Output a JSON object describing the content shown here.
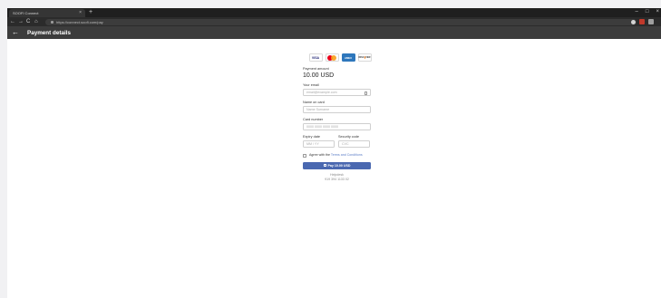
{
  "browser": {
    "tab_title": "SOOFI Connect",
    "tab_close": "×",
    "new_tab": "+",
    "url": "https://connect.soofi.com/pay",
    "controls": {
      "minimize": "–",
      "maximize": "□",
      "close": "×"
    },
    "nav": {
      "back": "←",
      "forward": "→",
      "reload": "C",
      "home": "⌂"
    }
  },
  "header": {
    "back_icon": "←",
    "title": "Payment details"
  },
  "payment": {
    "card_brands": [
      {
        "name": "VISA"
      },
      {
        "name": "Mastercard"
      },
      {
        "name": "AMERICAN EXPRESS"
      },
      {
        "name": "DISCOVER"
      }
    ],
    "amount_label": "Payment amount",
    "amount": "10.00 USD",
    "email_label": "Your email",
    "email_placeholder": "email@example.com",
    "name_label": "Name on card",
    "name_placeholder": "Name Surname",
    "card_label": "Card number",
    "card_placeholder": "0000 0000 0000 0000",
    "expiry_label": "Expiry date",
    "expiry_placeholder": "MM / YY",
    "cvc_label": "Security code",
    "cvc_placeholder": "CVC",
    "agree_prefix": "Agree with the",
    "agree_link": "Terms and Conditions",
    "pay_button": "Pay 10.00 USD",
    "footer_line1": "Helpdesk",
    "footer_line2": "919 394 1133 02"
  },
  "colors": {
    "appbar": "#3c3c3c",
    "button": "#4a68b0",
    "link": "#5b7dc7"
  }
}
